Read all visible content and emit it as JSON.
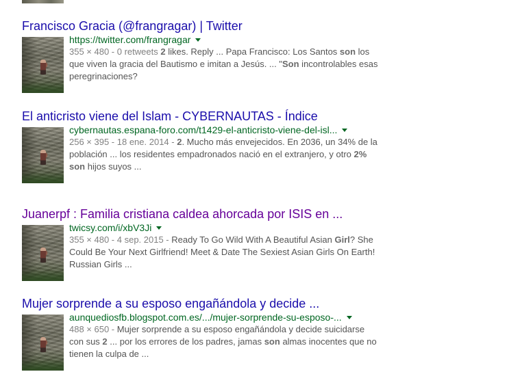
{
  "results": [
    {
      "title": "Francisco Gracia (@frangragar) | Twitter",
      "visited": false,
      "url": "https://twitter.com/frangragar",
      "snippet": [
        {
          "t": "355 × 480 - 0 retweets ",
          "b": false,
          "meta": true
        },
        {
          "t": "2",
          "b": true
        },
        {
          "t": " likes. Reply ... Papa Francisco: Los Santos ",
          "b": false
        },
        {
          "t": "son",
          "b": true
        },
        {
          "t": " los que viven la gracia del Bautismo e imitan a Jesús. ... \"",
          "b": false
        },
        {
          "t": "Son",
          "b": true
        },
        {
          "t": " incontrolables esas peregrinaciones?",
          "b": false
        }
      ]
    },
    {
      "title": "El anticristo viene del Islam - CYBERNAUTAS - Índice",
      "visited": false,
      "url": "cybernautas.espana-foro.com/t1429-el-anticristo-viene-del-isl...",
      "snippet": [
        {
          "t": "256 × 395 - 18 ene. 2014 - ",
          "b": false,
          "meta": true
        },
        {
          "t": "2",
          "b": true
        },
        {
          "t": ". Mucho más envejecidos. En 2036, un 34% de la población ... los residentes empadronados nació en el extranjero, y otro ",
          "b": false
        },
        {
          "t": "2%",
          "b": true
        },
        {
          "t": " ",
          "b": false
        },
        {
          "t": "son",
          "b": true
        },
        {
          "t": " hijos suyos ...",
          "b": false
        }
      ]
    },
    {
      "title": "Juanerpf : Familia cristiana caldea ahorcada por ISIS en ...",
      "visited": true,
      "url": "twicsy.com/i/xbV3Ji",
      "snippet": [
        {
          "t": "355 × 480 - 4 sep. 2015 - ",
          "b": false,
          "meta": true
        },
        {
          "t": "Ready To Go Wild With A Beautiful Asian ",
          "b": false
        },
        {
          "t": "Girl",
          "b": true
        },
        {
          "t": "? She Could Be Your Next Girlfriend! Meet & Date The Sexiest Asian Girls On Earth! Russian Girls ...",
          "b": false
        }
      ]
    },
    {
      "title": "Mujer sorprende a su esposo engañándola y decide ...",
      "visited": false,
      "url": "aunquediosfb.blogspot.com.es/.../mujer-sorprende-su-esposo-...",
      "snippet": [
        {
          "t": "488 × 650 - ",
          "b": false,
          "meta": true
        },
        {
          "t": "Mujer sorprende a su esposo engañándola y decide suicidarse con sus ",
          "b": false
        },
        {
          "t": "2",
          "b": true
        },
        {
          "t": " ... por los errores de los padres, jamas ",
          "b": false
        },
        {
          "t": "son",
          "b": true
        },
        {
          "t": " almas inocentes que no tienen la culpa de ...",
          "b": false
        }
      ]
    }
  ]
}
